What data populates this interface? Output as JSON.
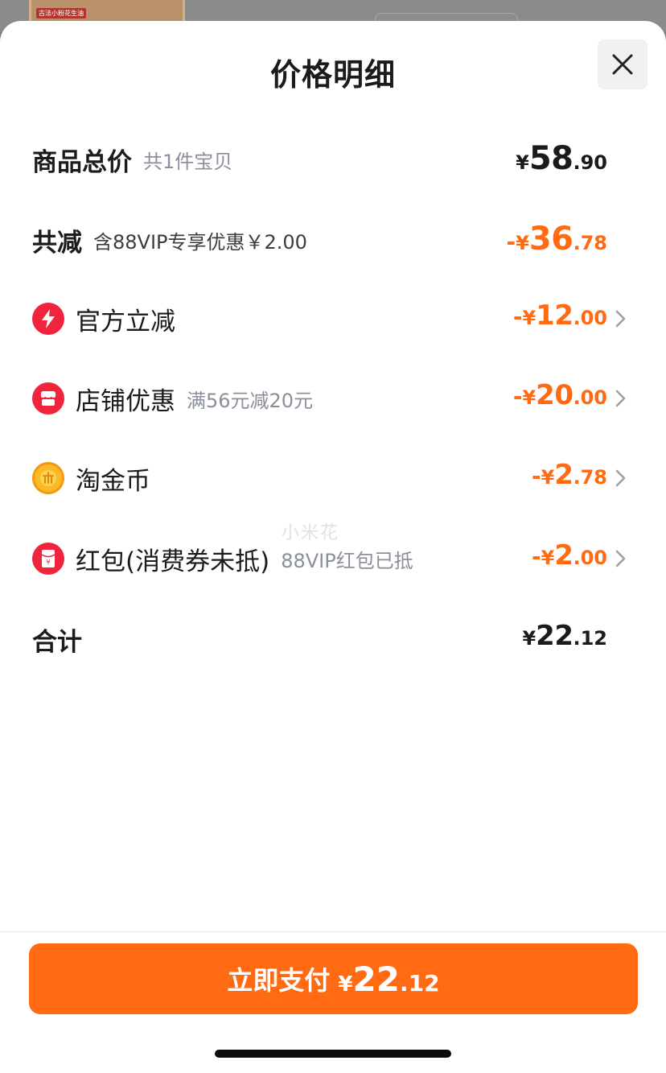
{
  "background": {
    "thumb_label": "古法小粉花生油"
  },
  "sheet": {
    "title": "价格明细",
    "close_icon": "close-icon"
  },
  "rows": {
    "subtotal": {
      "label": "商品总价",
      "sub": "共1件宝贝",
      "currency": "¥",
      "amount_int": "58",
      "amount_dec": ".90"
    },
    "total_discount": {
      "label": "共减",
      "sub": "含88VIP专享优惠￥2.00",
      "minus": "-",
      "currency": "¥",
      "amount_int": "36",
      "amount_dec": ".78"
    },
    "official": {
      "icon": "lightning-icon",
      "label": "官方立减",
      "minus": "-",
      "currency": "¥",
      "amount_int": "12",
      "amount_dec": ".00"
    },
    "store": {
      "icon": "shop-icon",
      "label": "店铺优惠",
      "sub": "满56元减20元",
      "minus": "-",
      "currency": "¥",
      "amount_int": "20",
      "amount_dec": ".00"
    },
    "coins": {
      "icon": "gold-coin-icon",
      "label": "淘金币",
      "minus": "-",
      "currency": "¥",
      "amount_int": "2",
      "amount_dec": ".78"
    },
    "redpacket": {
      "icon": "red-packet-icon",
      "label": "红包(消费券未抵)",
      "sub": "88VIP红包已抵",
      "minus": "-",
      "currency": "¥",
      "amount_int": "2",
      "amount_dec": ".00"
    },
    "grand_total": {
      "label": "合计",
      "currency": "¥",
      "amount_int": "22",
      "amount_dec": ".12"
    }
  },
  "watermark": "小米花",
  "footer": {
    "pay_label": "立即支付",
    "currency": "¥",
    "amount_int": "22",
    "amount_dec": ".12"
  },
  "colors": {
    "accent": "#ff6a12",
    "text": "#1b1b1b",
    "subtext": "#8a8f99"
  }
}
